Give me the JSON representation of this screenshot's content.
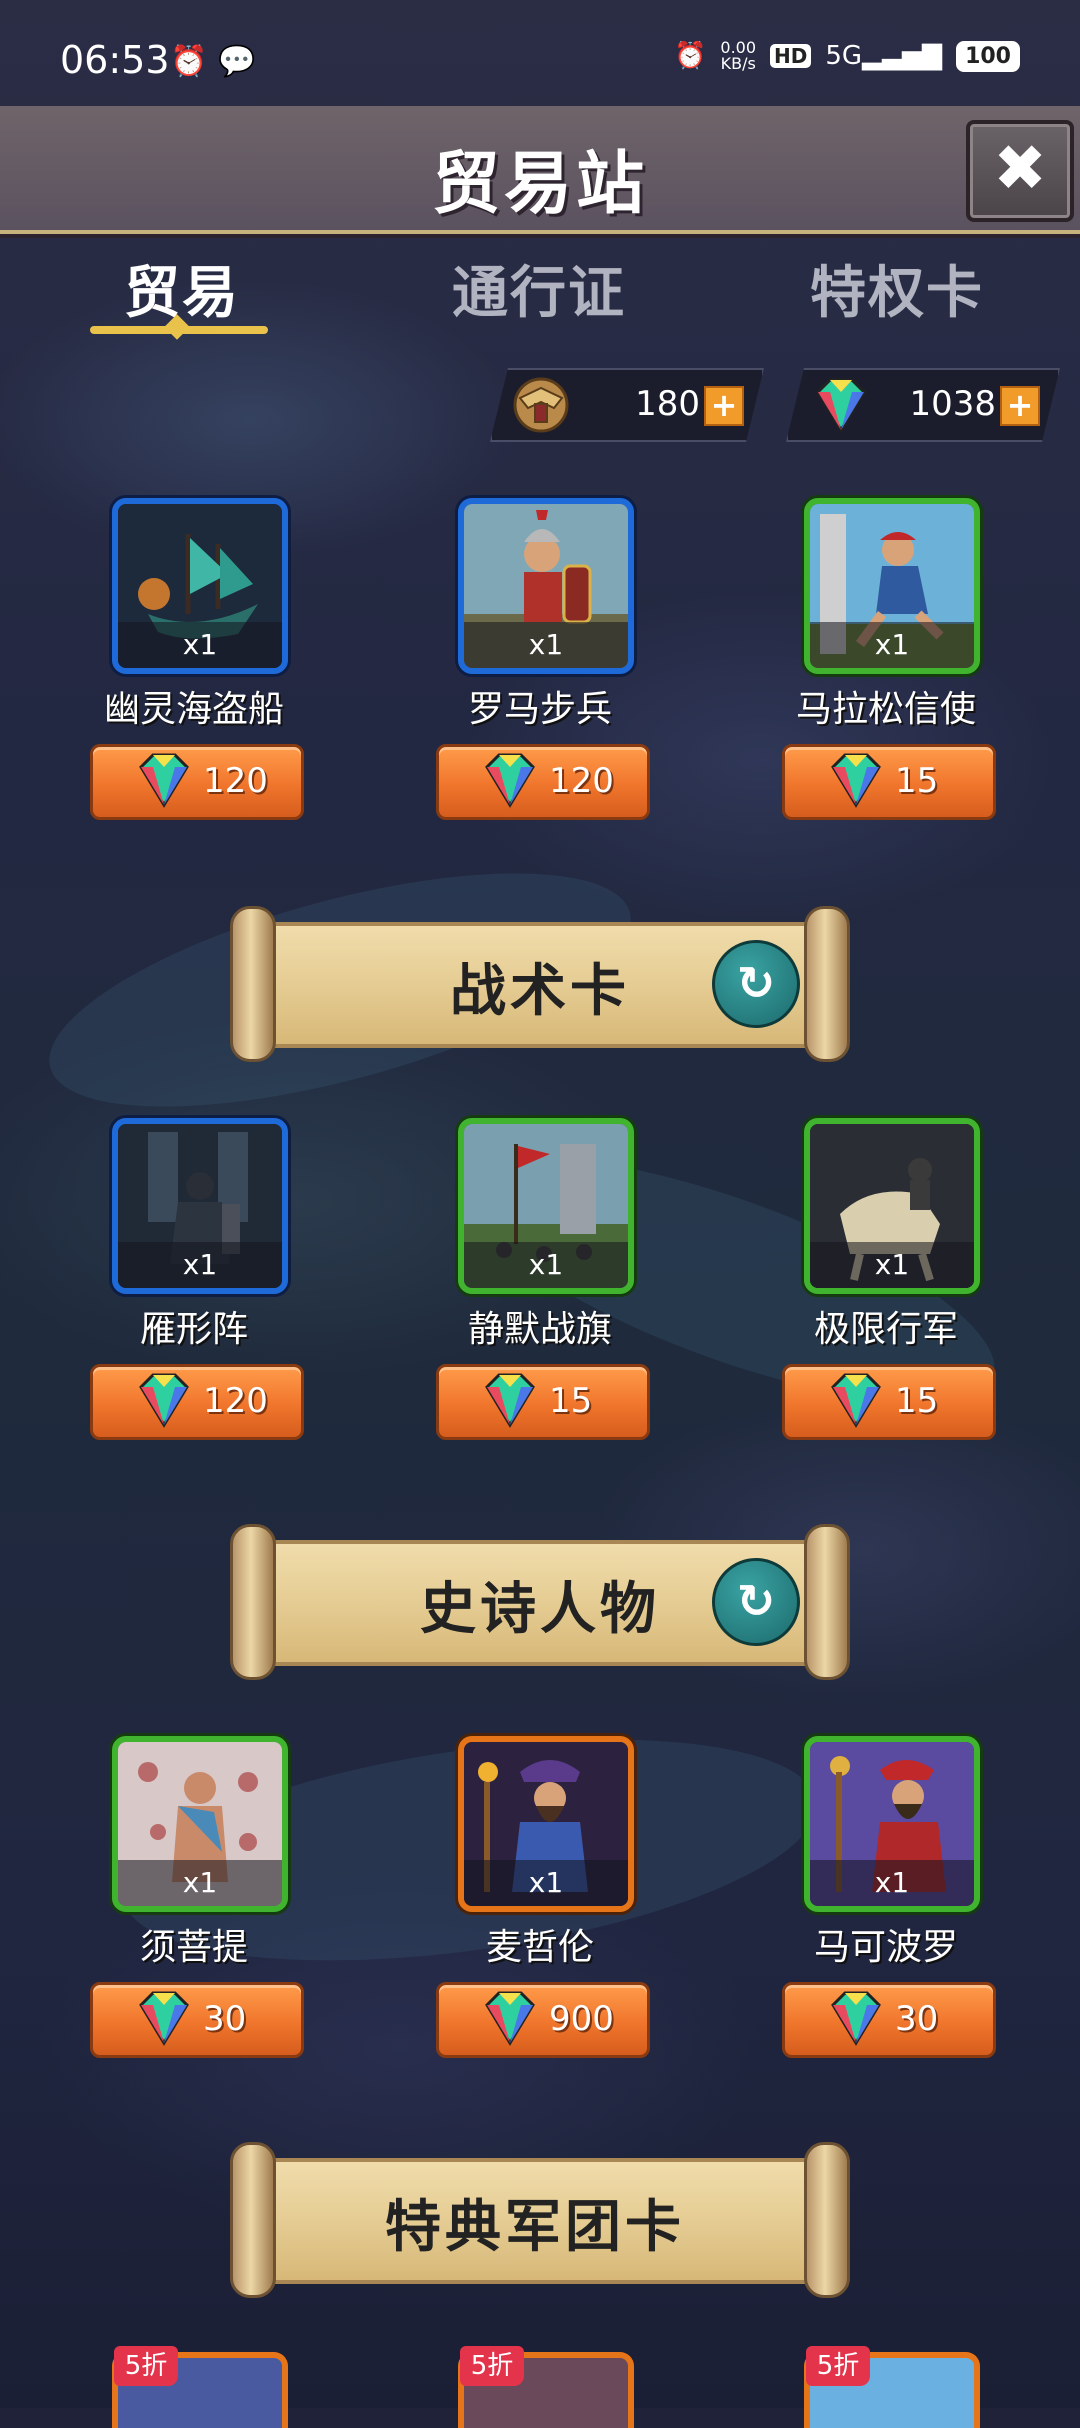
{
  "status_bar": {
    "time": "06:53",
    "net_speed_top": "0.00",
    "net_speed_unit": "KB/s",
    "hd": "HD",
    "signal": "5G",
    "battery": "100"
  },
  "header": {
    "title": "贸易站",
    "close_symbol": "✖"
  },
  "tabs": [
    {
      "label": "贸易",
      "active": true
    },
    {
      "label": "通行证",
      "active": false
    },
    {
      "label": "特权卡",
      "active": false
    }
  ],
  "currency": {
    "badge_amount": "180",
    "gem_amount": "1038",
    "plus": "+"
  },
  "sections": [
    {
      "title": "",
      "items": [
        {
          "name": "幽灵海盗船",
          "qty": "x1",
          "price": "120",
          "frame": "blue"
        },
        {
          "name": "罗马步兵",
          "qty": "x1",
          "price": "120",
          "frame": "blue"
        },
        {
          "name": "马拉松信使",
          "qty": "x1",
          "price": "15",
          "frame": "green"
        }
      ]
    },
    {
      "title": "战术卡",
      "items": [
        {
          "name": "雁形阵",
          "qty": "x1",
          "price": "120",
          "frame": "blue"
        },
        {
          "name": "静默战旗",
          "qty": "x1",
          "price": "15",
          "frame": "green"
        },
        {
          "name": "极限行军",
          "qty": "x1",
          "price": "15",
          "frame": "green"
        }
      ]
    },
    {
      "title": "史诗人物",
      "items": [
        {
          "name": "须菩提",
          "qty": "x1",
          "price": "30",
          "frame": "green"
        },
        {
          "name": "麦哲伦",
          "qty": "x1",
          "price": "900",
          "frame": "orange"
        },
        {
          "name": "马可波罗",
          "qty": "x1",
          "price": "30",
          "frame": "green"
        }
      ]
    },
    {
      "title": "特典军团卡",
      "discount_label": "5折"
    }
  ],
  "colors": {
    "accent_gold": "#e8c24b",
    "price_orange": "#f0752c",
    "frame_blue": "#1e6ad8",
    "frame_green": "#40b42f",
    "frame_orange": "#e67418"
  }
}
